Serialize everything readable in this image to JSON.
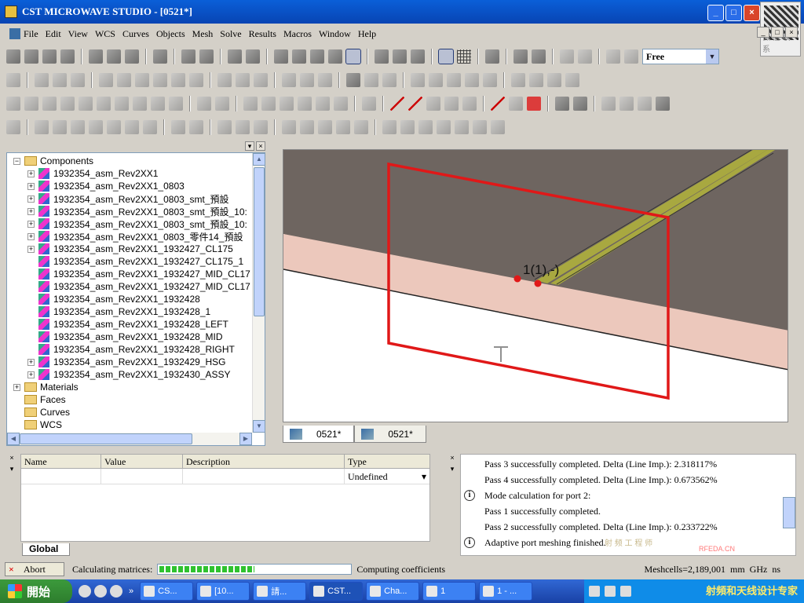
{
  "window": {
    "title": "CST MICROWAVE STUDIO - [0521*]",
    "controls": [
      "_",
      "□",
      "×"
    ]
  },
  "watermark_qr_text": "微 信 联 系",
  "mdi_controls": [
    "_",
    "□",
    "×"
  ],
  "menu": [
    "File",
    "Edit",
    "View",
    "WCS",
    "Curves",
    "Objects",
    "Mesh",
    "Solve",
    "Results",
    "Macros",
    "Window",
    "Help"
  ],
  "toolbar": {
    "mode_select": {
      "value": "Free",
      "arrow": "▼"
    }
  },
  "tree": {
    "panel_controls": [
      "▾",
      "×"
    ],
    "items": [
      {
        "label": "Components",
        "kind": "folder-root",
        "expander": "−"
      },
      {
        "label": "1932354_asm_Rev2XX1",
        "kind": "component",
        "expander": "+"
      },
      {
        "label": "1932354_asm_Rev2XX1_0803",
        "kind": "component",
        "expander": "+"
      },
      {
        "label": "1932354_asm_Rev2XX1_0803_smt_預設",
        "kind": "component",
        "expander": "+"
      },
      {
        "label": "1932354_asm_Rev2XX1_0803_smt_預設_10:",
        "kind": "component",
        "expander": "+"
      },
      {
        "label": "1932354_asm_Rev2XX1_0803_smt_預設_10:",
        "kind": "component",
        "expander": "+"
      },
      {
        "label": "1932354_asm_Rev2XX1_0803_零件14_預設",
        "kind": "component",
        "expander": "+"
      },
      {
        "label": "1932354_asm_Rev2XX1_1932427_CL175",
        "kind": "component",
        "expander": "+"
      },
      {
        "label": "1932354_asm_Rev2XX1_1932427_CL175_1",
        "kind": "component",
        "expander": ""
      },
      {
        "label": "1932354_asm_Rev2XX1_1932427_MID_CL17",
        "kind": "component",
        "expander": ""
      },
      {
        "label": "1932354_asm_Rev2XX1_1932427_MID_CL17",
        "kind": "component",
        "expander": ""
      },
      {
        "label": "1932354_asm_Rev2XX1_1932428",
        "kind": "component",
        "expander": ""
      },
      {
        "label": "1932354_asm_Rev2XX1_1932428_1",
        "kind": "component",
        "expander": ""
      },
      {
        "label": "1932354_asm_Rev2XX1_1932428_LEFT",
        "kind": "component",
        "expander": ""
      },
      {
        "label": "1932354_asm_Rev2XX1_1932428_MID",
        "kind": "component",
        "expander": ""
      },
      {
        "label": "1932354_asm_Rev2XX1_1932428_RIGHT",
        "kind": "component",
        "expander": ""
      },
      {
        "label": "1932354_asm_Rev2XX1_1932429_HSG",
        "kind": "component",
        "expander": "+"
      },
      {
        "label": "1932354_asm_Rev2XX1_1932430_ASSY",
        "kind": "component",
        "expander": "+"
      },
      {
        "label": "Materials",
        "kind": "folder",
        "expander": "+"
      },
      {
        "label": "Faces",
        "kind": "folder",
        "expander": ""
      },
      {
        "label": "Curves",
        "kind": "folder",
        "expander": ""
      },
      {
        "label": "WCS",
        "kind": "folder",
        "expander": ""
      }
    ]
  },
  "view3d": {
    "port_label": "1(1),-)",
    "port_label_2": "(1),-)",
    "colors": {
      "background_top": "#6e6560",
      "substrate": "#ecc8bc",
      "trace": "#a8a840",
      "port_frame": "#e01818",
      "point": "#e01818"
    },
    "tabs": [
      {
        "label": "0521*",
        "active": true
      },
      {
        "label": "0521*",
        "active": false
      }
    ]
  },
  "parameters": {
    "side_controls": [
      "×",
      "▾"
    ],
    "columns": [
      "Name",
      "Value",
      "Description",
      "Type"
    ],
    "row": {
      "name": "",
      "value": "",
      "description": "",
      "type": "Undefined"
    },
    "tab": "Global"
  },
  "messages": {
    "side_controls": [
      "×",
      "▾"
    ],
    "items": [
      {
        "icon": "",
        "text": "Pass 3 successfully completed. Delta (Line Imp.): 2.318117%"
      },
      {
        "icon": "",
        "text": "Pass 4 successfully completed. Delta (Line Imp.): 0.673562%"
      },
      {
        "icon": "i",
        "text": "Mode calculation for port 2:"
      },
      {
        "icon": "",
        "text": "Pass 1 successfully completed."
      },
      {
        "icon": "",
        "text": "Pass 2 successfully completed. Delta (Line Imp.): 0.233722%"
      },
      {
        "icon": "i",
        "text": "Adaptive port meshing finished."
      }
    ]
  },
  "status": {
    "abort_label": "Abort",
    "abort_icon": "×",
    "task": "Calculating matrices:",
    "progress_fraction": 0.5,
    "subtask": "Computing coefficients",
    "meshcells": "Meshcells=2,189,001",
    "units": [
      "mm",
      "GHz",
      "ns"
    ]
  },
  "taskbar": {
    "start_label": "開始",
    "quick_overflow": "»",
    "tasks": [
      {
        "label": "CS...",
        "active": false
      },
      {
        "label": "[10...",
        "active": false
      },
      {
        "label": "請...",
        "active": false
      },
      {
        "label": "CST...",
        "active": true
      },
      {
        "label": "Cha...",
        "active": false
      },
      {
        "label": "1",
        "active": false
      },
      {
        "label": "1 - ...",
        "active": false
      }
    ],
    "tray_text": "射頻和天线设计专家"
  },
  "watermarks": {
    "rfeda": "RFEDA.CN",
    "faint": "射 频 工 程 师"
  }
}
